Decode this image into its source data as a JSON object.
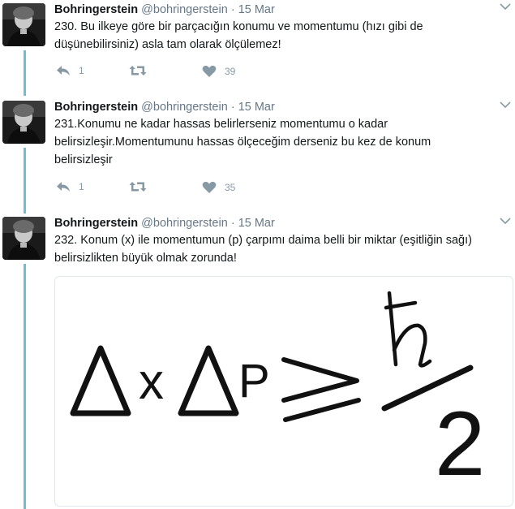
{
  "tweets": [
    {
      "name": "Bohringerstein",
      "handle": "@bohringerstein",
      "dot": "·",
      "date": "15 Mar",
      "text": "230. Bu ilkeye göre bir parçacığın konumu ve momentumu (hızı gibi de\ndüşünebilirsiniz) asla tam olarak ölçülemez!",
      "reply_count": "1",
      "retweet_count": "",
      "like_count": "39"
    },
    {
      "name": "Bohringerstein",
      "handle": "@bohringerstein",
      "dot": "·",
      "date": "15 Mar",
      "text": "231.Konumu ne kadar hassas belirlerseniz momentumu o kadar\nbelirsizleşir.Momentumunu hassas ölçeceğim derseniz bu kez de konum\nbelirsizleşir",
      "reply_count": "1",
      "retweet_count": "",
      "like_count": "35"
    },
    {
      "name": "Bohringerstein",
      "handle": "@bohringerstein",
      "dot": "·",
      "date": "15 Mar",
      "text": "232. Konum (x) ile momentumun (p) çarpımı daima belli bir miktar (eşitliğin sağı)\nbelirsizlikten büyük olmak zorunda!"
    }
  ],
  "media": {
    "formula_x": "x",
    "formula_p": "P",
    "formula_denominator": "2",
    "icon": "uncertainty-principle-formula"
  },
  "colors": {
    "thread_line": "#6bc0d8",
    "muted": "#657786",
    "icon": "#8899a6"
  }
}
